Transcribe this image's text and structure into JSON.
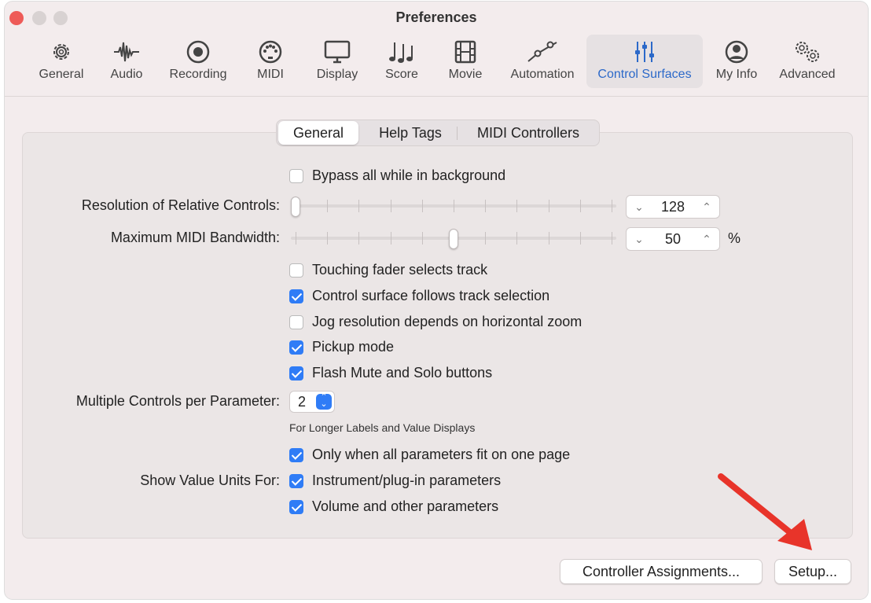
{
  "window": {
    "title": "Preferences"
  },
  "toolbar": {
    "items": [
      {
        "label": "General",
        "icon": "gear-icon"
      },
      {
        "label": "Audio",
        "icon": "waveform-icon"
      },
      {
        "label": "Recording",
        "icon": "record-icon"
      },
      {
        "label": "MIDI",
        "icon": "midi-port-icon"
      },
      {
        "label": "Display",
        "icon": "monitor-icon"
      },
      {
        "label": "Score",
        "icon": "music-notes-icon"
      },
      {
        "label": "Movie",
        "icon": "film-icon"
      },
      {
        "label": "Automation",
        "icon": "automation-curve-icon"
      },
      {
        "label": "Control Surfaces",
        "icon": "sliders-icon",
        "active": true
      },
      {
        "label": "My Info",
        "icon": "person-icon"
      },
      {
        "label": "Advanced",
        "icon": "gears-icon"
      }
    ]
  },
  "tabs": [
    "General",
    "Help Tags",
    "MIDI Controllers"
  ],
  "selected_tab": "General",
  "settings": {
    "bypass_background": {
      "label": "Bypass all while in background",
      "checked": false
    },
    "resolution": {
      "label": "Resolution of Relative Controls:",
      "value": "128",
      "slider_fraction": 0.0
    },
    "bandwidth": {
      "label": "Maximum MIDI Bandwidth:",
      "value": "50",
      "unit": "%",
      "slider_fraction": 0.5
    },
    "touching_fader": {
      "label": "Touching fader selects track",
      "checked": false
    },
    "follows_selection": {
      "label": "Control surface follows track selection",
      "checked": true
    },
    "jog_resolution": {
      "label": "Jog resolution depends on horizontal zoom",
      "checked": false
    },
    "pickup_mode": {
      "label": "Pickup mode",
      "checked": true
    },
    "flash_mute": {
      "label": "Flash Mute and Solo buttons",
      "checked": true
    },
    "multiple_controls": {
      "label": "Multiple Controls per Parameter:",
      "value": "2"
    },
    "longer_labels_note": "For Longer Labels and Value Displays",
    "only_when_fit": {
      "label": "Only when all parameters fit on one page",
      "checked": true
    },
    "show_units_label": "Show Value Units For:",
    "instrument_params": {
      "label": "Instrument/plug-in parameters",
      "checked": true
    },
    "volume_params": {
      "label": "Volume and other parameters",
      "checked": true
    }
  },
  "buttons": {
    "controller_assignments": "Controller Assignments...",
    "setup": "Setup..."
  },
  "colors": {
    "accent": "#2f7cf6",
    "annotation_arrow": "#e8342a",
    "window_bg": "#f3eced"
  }
}
